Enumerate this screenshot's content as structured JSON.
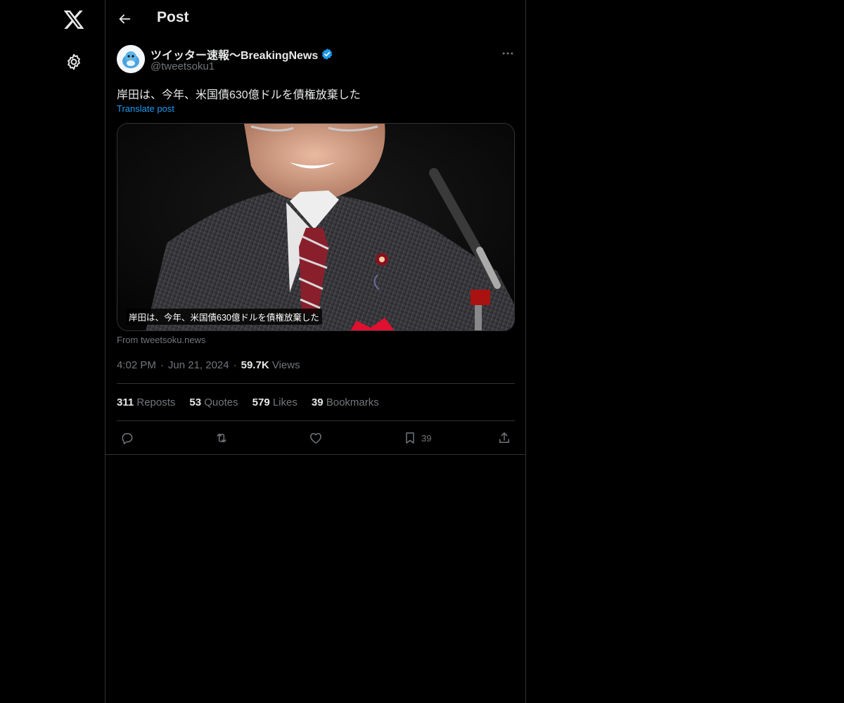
{
  "header": {
    "title": "Post"
  },
  "author": {
    "name": "ツイッター速報〜BreakingNews",
    "handle": "@tweetsoku1",
    "verified": true
  },
  "post": {
    "text": "岸田は、今年、米国債630億ドルを債権放棄した",
    "translate_label": "Translate post",
    "media_caption": "岸田は、今年、米国債630億ドルを債権放棄した",
    "source": "From tweetsoku.news"
  },
  "meta": {
    "time": "4:02 PM",
    "date": "Jun 21, 2024",
    "views_count": "59.7K",
    "views_label": "Views"
  },
  "stats": {
    "reposts_count": "311",
    "reposts_label": "Reposts",
    "quotes_count": "53",
    "quotes_label": "Quotes",
    "likes_count": "579",
    "likes_label": "Likes",
    "bookmarks_count": "39",
    "bookmarks_label": "Bookmarks"
  },
  "actions": {
    "bookmark_count": "39"
  },
  "icons": {
    "logo": "x-logo-icon",
    "settings": "gear-icon",
    "back": "arrow-left-icon",
    "more": "more-horizontal-icon",
    "verified": "verified-badge-icon",
    "reply": "reply-icon",
    "repost": "repost-icon",
    "like": "heart-icon",
    "bookmark": "bookmark-icon",
    "share": "share-icon"
  },
  "colors": {
    "background": "#000000",
    "text": "#e7e9ea",
    "muted": "#71767b",
    "link": "#1d9bf0",
    "border": "#2f3336"
  }
}
